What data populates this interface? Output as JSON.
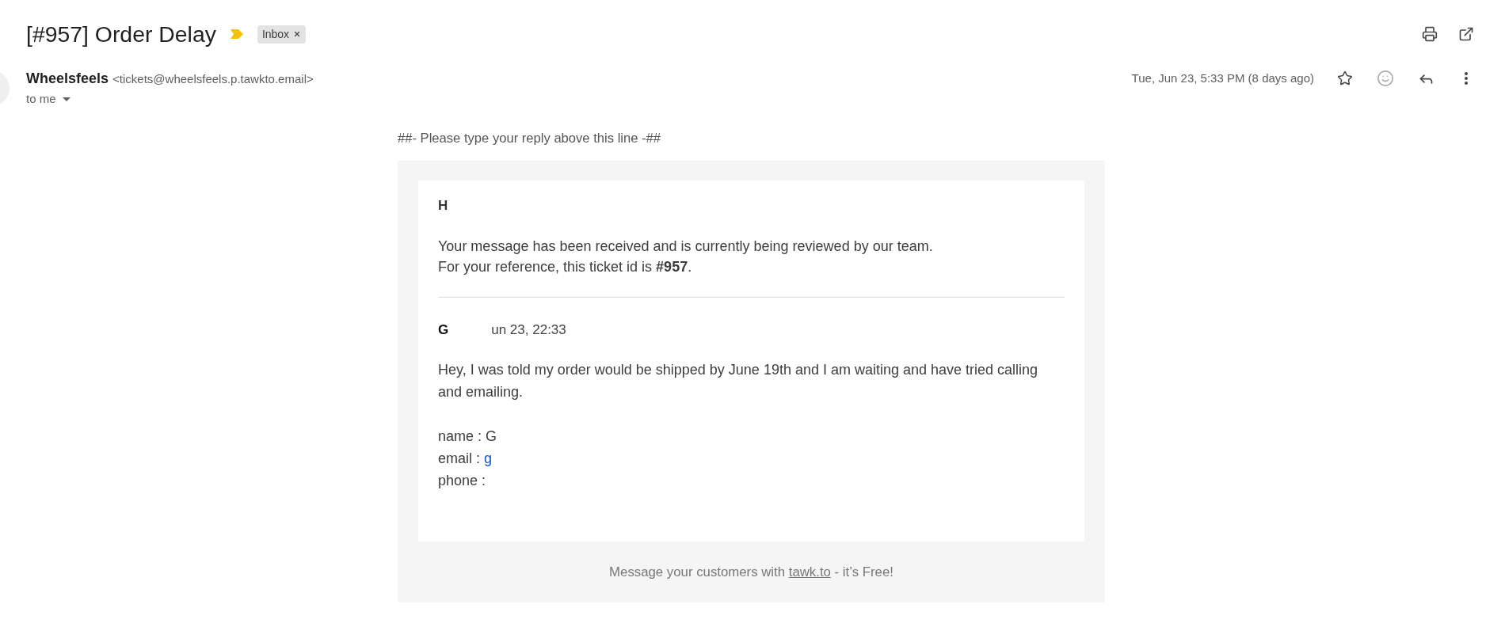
{
  "subject": {
    "title": "[#957] Order Delay",
    "important": true,
    "labels": [
      {
        "text": "Inbox"
      }
    ]
  },
  "sender": {
    "name": "Wheelsfeels",
    "address": "<tickets@wheelsfeels.p.tawkto.email>",
    "recipient": "to me",
    "date": "Tue, Jun 23, 5:33 PM (8 days ago)",
    "starred": false
  },
  "message": {
    "reply_marker": "##- Please type your reply above this line -##",
    "card": {
      "greeting": "H",
      "notice": [
        "Your message has been received and is currently being reviewed by our team.",
        "For your reference, this ticket id is **#957**."
      ],
      "quoted": {
        "author": "G",
        "date": "un 23, 22:33",
        "text": "Hey, I was told my order would be shipped by June 19th and I am waiting and have tried calling and emailing.",
        "details": [
          {
            "label": "name :",
            "value": "G",
            "kind": "text"
          },
          {
            "label": "email :",
            "value": "g",
            "kind": "link"
          },
          {
            "label": "phone :"
          }
        ]
      }
    },
    "footer": {
      "text_before": "Message your customers with",
      "link": "tawk.to",
      "text_after": "- it’s Free!"
    }
  }
}
